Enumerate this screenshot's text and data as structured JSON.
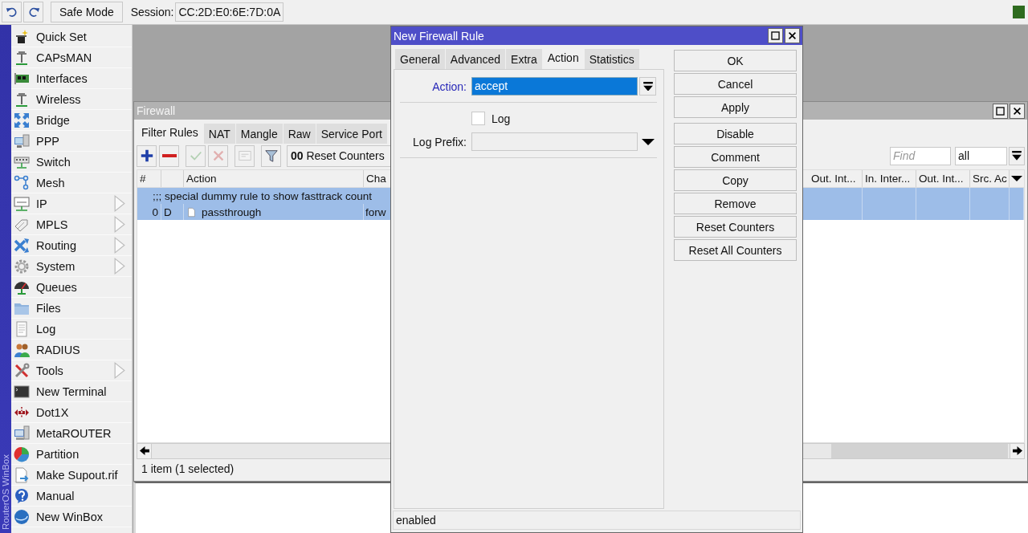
{
  "topbar": {
    "buttons": [
      {
        "kind": "undo"
      },
      {
        "kind": "redo"
      }
    ],
    "safe_mode": "Safe Mode",
    "session_label": "Session:",
    "session": "CC:2D:E0:6E:7D:0A"
  },
  "sidebar": {
    "brand": "RouterOS WinBox",
    "items": [
      {
        "label": "Quick Set",
        "kind": "wand",
        "submenu": false
      },
      {
        "label": "CAPsMAN",
        "kind": "antenna",
        "submenu": false
      },
      {
        "label": "Interfaces",
        "kind": "card",
        "submenu": false
      },
      {
        "label": "Wireless",
        "kind": "antenna",
        "submenu": false
      },
      {
        "label": "Bridge",
        "kind": "arrows",
        "submenu": false
      },
      {
        "label": "PPP",
        "kind": "monitor",
        "submenu": false
      },
      {
        "label": "Switch",
        "kind": "switch",
        "submenu": false
      },
      {
        "label": "Mesh",
        "kind": "nodes",
        "submenu": false
      },
      {
        "label": "IP",
        "kind": "panel",
        "submenu": true
      },
      {
        "label": "MPLS",
        "kind": "tags",
        "submenu": true
      },
      {
        "label": "Routing",
        "kind": "routing",
        "submenu": true
      },
      {
        "label": "System",
        "kind": "gear",
        "submenu": true
      },
      {
        "label": "Queues",
        "kind": "gauge",
        "submenu": false
      },
      {
        "label": "Files",
        "kind": "folder",
        "submenu": false
      },
      {
        "label": "Log",
        "kind": "document",
        "submenu": false
      },
      {
        "label": "RADIUS",
        "kind": "people",
        "submenu": false
      },
      {
        "label": "Tools",
        "kind": "tools",
        "submenu": true
      },
      {
        "label": "New Terminal",
        "kind": "terminal",
        "submenu": false
      },
      {
        "label": "Dot1X",
        "kind": "dot1x",
        "submenu": false
      },
      {
        "label": "MetaROUTER",
        "kind": "computers",
        "submenu": false
      },
      {
        "label": "Partition",
        "kind": "pie",
        "submenu": false
      },
      {
        "label": "Make Supout.rif",
        "kind": "docarrow",
        "submenu": false
      },
      {
        "label": "Manual",
        "kind": "help",
        "submenu": false
      },
      {
        "label": "New WinBox",
        "kind": "globe",
        "submenu": false
      }
    ]
  },
  "firewall": {
    "title": "Firewall",
    "tabs": [
      {
        "label": "Filter Rules",
        "selected": true
      },
      {
        "label": "NAT",
        "selected": false
      },
      {
        "label": "Mangle",
        "selected": false
      },
      {
        "label": "Raw",
        "selected": false
      },
      {
        "label": "Service Port",
        "selected": false
      }
    ],
    "tools": [
      {
        "kind": "add",
        "disabled": false
      },
      {
        "kind": "remove",
        "disabled": false
      },
      {
        "kind": "enable",
        "disabled": true
      },
      {
        "kind": "disable",
        "disabled": true
      },
      {
        "kind": "comment",
        "disabled": true
      },
      {
        "kind": "filter",
        "disabled": false
      }
    ],
    "reset_counters": "**00** Reset Counters",
    "find": {
      "placeholder": "Find"
    },
    "filter": "all",
    "columns_left": [
      "#",
      "Action",
      "Cha"
    ],
    "columns_right": [
      "Out. Int...",
      "In. Inter...",
      "Out. Int...",
      "Src. Ac"
    ],
    "rows": [
      {
        "kind": "comment",
        "text": ";;; special dummy rule to show fasttrack count",
        "selected": true
      },
      {
        "kind": "rule",
        "number": "0",
        "flags": "D",
        "action": "passthrough",
        "chain": "forw",
        "selected": true
      }
    ],
    "status": "1 item (1 selected)"
  },
  "dialog": {
    "title": "New Firewall Rule",
    "tabs": [
      {
        "label": "General",
        "selected": false
      },
      {
        "label": "Advanced",
        "selected": false
      },
      {
        "label": "Extra",
        "selected": false
      },
      {
        "label": "Action",
        "selected": true
      },
      {
        "label": "Statistics",
        "selected": false
      }
    ],
    "fields": [
      {
        "kind": "select",
        "label": "Action:",
        "value": "accept",
        "focused": true
      },
      {
        "kind": "checkbox",
        "label": "Log",
        "checked": false
      },
      {
        "kind": "combo",
        "label": "Log Prefix:"
      }
    ],
    "buttons": [
      "OK",
      "Cancel",
      "Apply",
      "Disable",
      "Comment",
      "Copy",
      "Remove",
      "Reset Counters",
      "Reset All Counters"
    ],
    "status": "enabled"
  }
}
